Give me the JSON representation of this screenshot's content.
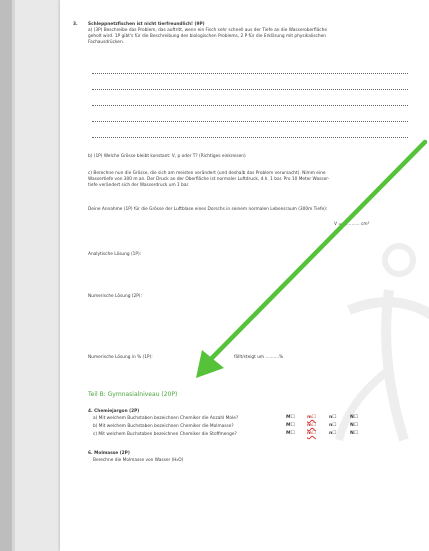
{
  "q3": {
    "number": "3.",
    "title": "Schleppnetzfischen ist nicht tierfreundlich! (9P)",
    "a_line1": "a) (3P) Beschreibe das Problem, das auftritt, wenn ein Fisch sehr schnell aus der Tiefe an die Wasseroberfläche",
    "a_line2": "geholt wird. 1P gibt's für die Beschreibung des biologischen Problems, 2 P für die Erklärung mit physikalischen",
    "a_line3": "Fachausdrücken.",
    "b_text": "b) (1P) Welche Grösse bleibt konstant: V,   p  oder  T? (Richtiges einkreisen)",
    "c_line1": "c) Berechne nun die Grösse, die sich am meisten verändert (und deshalb das Problem verursacht). Nimm eine",
    "c_line2": "Wassertiefe von 300 m an. Der Druck an der Oberfläche ist normaler Luftdruck, d.h. 1 bar. Pro 10 Meter Wasser-",
    "c_line3": "tiefe verändert sich der Wasserdruck um 1 bar.",
    "assumption": "Deine Annahme (1P) für die Grösse der Luftblase eines Dorschs in seinem normalen Lebensraum (300m Tiefe):",
    "volume": "V = ............ cm³",
    "analytic": "Analytische Lösung (1P):",
    "numeric": "Numerische Lösung (2P):",
    "percent_label": "Numerische Lösung in % (1P):",
    "percent_fill": "fällt/steigt um ..........%"
  },
  "section_b": "Teil B: Gymnasialniveau (20P)",
  "q4": {
    "title": "4.  Chemiejargon (2P)",
    "items": [
      {
        "text": "a) Mit welchem Buchstaben bezeichnen Chemiker die Anzahl Mole?"
      },
      {
        "text": "b) Mit welchem Buchstaben bezeichnen Chemiker die Molmasse?"
      },
      {
        "text": "c) Mit welchem Buchstaben bezeichnen Chemiker die Stoffmenge?"
      }
    ],
    "options": [
      "M☐",
      "m☐",
      "n☐",
      "N☐"
    ]
  },
  "q6": {
    "title": "6.  Molmasse (2P)",
    "text": "Berechne die Molmasse von Wasser (H₂O)"
  },
  "colors": {
    "arrow": "#55c23a",
    "section": "#4aa63a"
  }
}
